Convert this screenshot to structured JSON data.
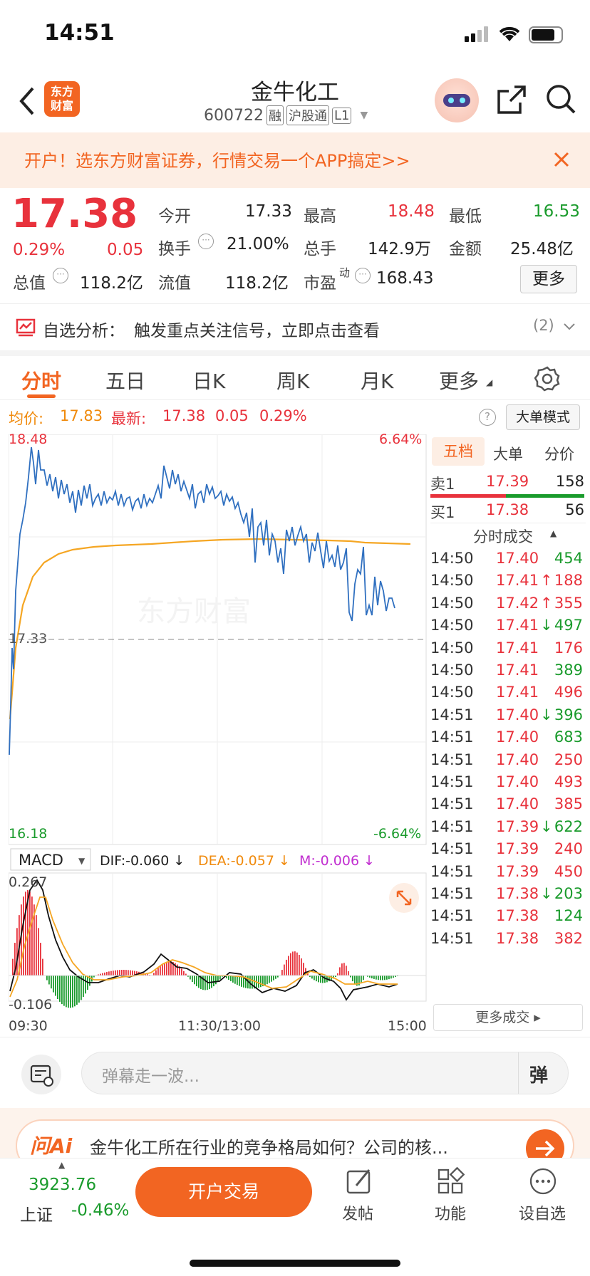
{
  "status": {
    "time": "14:51"
  },
  "header": {
    "title": "金牛化工",
    "code": "600722",
    "tags": [
      "融",
      "沪股通",
      "L1"
    ]
  },
  "banner": {
    "text": "开户！选东方财富证券，行情交易一个APP搞定>>"
  },
  "quote": {
    "price": "17.38",
    "pct": "0.29%",
    "change": "0.05",
    "fields": [
      {
        "label": "今开",
        "value": "17.33"
      },
      {
        "label": "最高",
        "value": "18.48"
      },
      {
        "label": "最低",
        "value": "16.53"
      },
      {
        "label": "换手",
        "value": "21.00%"
      },
      {
        "label": "总手",
        "value": "142.9万"
      },
      {
        "label": "金额",
        "value": "25.48亿"
      },
      {
        "label": "总值",
        "value": "118.2亿"
      },
      {
        "label": "流值",
        "value": "118.2亿"
      },
      {
        "label": "市盈",
        "value": "168.43"
      }
    ],
    "pe_sup": "动",
    "more": "更多"
  },
  "analysis": {
    "label": "自选分析：",
    "text": "触发重点关注信号，立即点击查看",
    "count": "(2)"
  },
  "tabs": [
    "分时",
    "五日",
    "日K",
    "周K",
    "月K",
    "更多"
  ],
  "chartinfo": {
    "avg_label": "均价:",
    "avg": "17.83",
    "latest_label": "最新:",
    "latest": "17.38",
    "chg": "0.05",
    "pct": "0.29%",
    "bigorder": "大单模式"
  },
  "chart": {
    "ymax": "18.48",
    "ymin": "16.18",
    "pmax": "6.64%",
    "pmin": "-6.64%",
    "base": "17.33",
    "watermark": "东方财富",
    "macd_sel": "MACD",
    "dif": "DIF:-0.060 ↓",
    "dea": "DEA:-0.057 ↓",
    "m": "M:-0.006 ↓",
    "macd_max": "0.267",
    "macd_min": "-0.106",
    "times": [
      "09:30",
      "11:30/13:00",
      "15:00"
    ]
  },
  "side": {
    "tabs": [
      "五档",
      "大单",
      "分价"
    ],
    "sell": {
      "label": "卖1",
      "price": "17.39",
      "vol": "158"
    },
    "buy": {
      "label": "买1",
      "price": "17.38",
      "vol": "56"
    },
    "trades_title": "分时成交",
    "trades": [
      [
        "14:50",
        "17.40",
        "",
        "454",
        "g"
      ],
      [
        "14:50",
        "17.41",
        "↑",
        "188",
        "r"
      ],
      [
        "14:50",
        "17.42",
        "↑",
        "355",
        "r"
      ],
      [
        "14:50",
        "17.41",
        "↓",
        "497",
        "g"
      ],
      [
        "14:50",
        "17.41",
        "",
        "176",
        "r"
      ],
      [
        "14:50",
        "17.41",
        "",
        "389",
        "g"
      ],
      [
        "14:50",
        "17.41",
        "",
        "496",
        "r"
      ],
      [
        "14:51",
        "17.40",
        "↓",
        "396",
        "g"
      ],
      [
        "14:51",
        "17.40",
        "",
        "683",
        "g"
      ],
      [
        "14:51",
        "17.40",
        "",
        "250",
        "r"
      ],
      [
        "14:51",
        "17.40",
        "",
        "493",
        "r"
      ],
      [
        "14:51",
        "17.40",
        "",
        "385",
        "r"
      ],
      [
        "14:51",
        "17.39",
        "↓",
        "622",
        "g"
      ],
      [
        "14:51",
        "17.39",
        "",
        "240",
        "r"
      ],
      [
        "14:51",
        "17.39",
        "",
        "450",
        "r"
      ],
      [
        "14:51",
        "17.38",
        "↓",
        "203",
        "g"
      ],
      [
        "14:51",
        "17.38",
        "",
        "124",
        "g"
      ],
      [
        "14:51",
        "17.38",
        "",
        "382",
        "r"
      ]
    ],
    "more": "更多成交"
  },
  "input": {
    "placeholder": "弹幕走一波...",
    "send": "弹"
  },
  "ai": {
    "logo": "问Ai",
    "text": "金牛化工所在行业的竞争格局如何？公司的核..."
  },
  "footer": {
    "index_value": "3923.76",
    "index_name": "上证",
    "index_pct": "-0.46%",
    "trade": "开户交易",
    "post": "发帖",
    "func": "功能",
    "watch": "设自选"
  }
}
